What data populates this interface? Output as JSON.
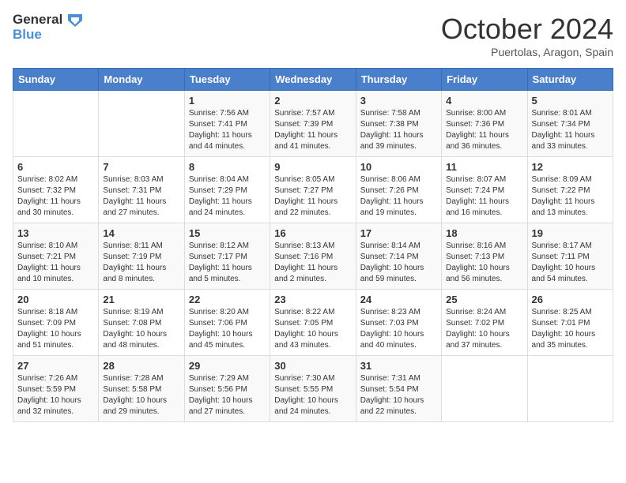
{
  "logo": {
    "line1": "General",
    "line2": "Blue"
  },
  "title": "October 2024",
  "subtitle": "Puertolas, Aragon, Spain",
  "days_header": [
    "Sunday",
    "Monday",
    "Tuesday",
    "Wednesday",
    "Thursday",
    "Friday",
    "Saturday"
  ],
  "weeks": [
    [
      {
        "num": "",
        "sunrise": "",
        "sunset": "",
        "daylight": ""
      },
      {
        "num": "",
        "sunrise": "",
        "sunset": "",
        "daylight": ""
      },
      {
        "num": "1",
        "sunrise": "Sunrise: 7:56 AM",
        "sunset": "Sunset: 7:41 PM",
        "daylight": "Daylight: 11 hours and 44 minutes."
      },
      {
        "num": "2",
        "sunrise": "Sunrise: 7:57 AM",
        "sunset": "Sunset: 7:39 PM",
        "daylight": "Daylight: 11 hours and 41 minutes."
      },
      {
        "num": "3",
        "sunrise": "Sunrise: 7:58 AM",
        "sunset": "Sunset: 7:38 PM",
        "daylight": "Daylight: 11 hours and 39 minutes."
      },
      {
        "num": "4",
        "sunrise": "Sunrise: 8:00 AM",
        "sunset": "Sunset: 7:36 PM",
        "daylight": "Daylight: 11 hours and 36 minutes."
      },
      {
        "num": "5",
        "sunrise": "Sunrise: 8:01 AM",
        "sunset": "Sunset: 7:34 PM",
        "daylight": "Daylight: 11 hours and 33 minutes."
      }
    ],
    [
      {
        "num": "6",
        "sunrise": "Sunrise: 8:02 AM",
        "sunset": "Sunset: 7:32 PM",
        "daylight": "Daylight: 11 hours and 30 minutes."
      },
      {
        "num": "7",
        "sunrise": "Sunrise: 8:03 AM",
        "sunset": "Sunset: 7:31 PM",
        "daylight": "Daylight: 11 hours and 27 minutes."
      },
      {
        "num": "8",
        "sunrise": "Sunrise: 8:04 AM",
        "sunset": "Sunset: 7:29 PM",
        "daylight": "Daylight: 11 hours and 24 minutes."
      },
      {
        "num": "9",
        "sunrise": "Sunrise: 8:05 AM",
        "sunset": "Sunset: 7:27 PM",
        "daylight": "Daylight: 11 hours and 22 minutes."
      },
      {
        "num": "10",
        "sunrise": "Sunrise: 8:06 AM",
        "sunset": "Sunset: 7:26 PM",
        "daylight": "Daylight: 11 hours and 19 minutes."
      },
      {
        "num": "11",
        "sunrise": "Sunrise: 8:07 AM",
        "sunset": "Sunset: 7:24 PM",
        "daylight": "Daylight: 11 hours and 16 minutes."
      },
      {
        "num": "12",
        "sunrise": "Sunrise: 8:09 AM",
        "sunset": "Sunset: 7:22 PM",
        "daylight": "Daylight: 11 hours and 13 minutes."
      }
    ],
    [
      {
        "num": "13",
        "sunrise": "Sunrise: 8:10 AM",
        "sunset": "Sunset: 7:21 PM",
        "daylight": "Daylight: 11 hours and 10 minutes."
      },
      {
        "num": "14",
        "sunrise": "Sunrise: 8:11 AM",
        "sunset": "Sunset: 7:19 PM",
        "daylight": "Daylight: 11 hours and 8 minutes."
      },
      {
        "num": "15",
        "sunrise": "Sunrise: 8:12 AM",
        "sunset": "Sunset: 7:17 PM",
        "daylight": "Daylight: 11 hours and 5 minutes."
      },
      {
        "num": "16",
        "sunrise": "Sunrise: 8:13 AM",
        "sunset": "Sunset: 7:16 PM",
        "daylight": "Daylight: 11 hours and 2 minutes."
      },
      {
        "num": "17",
        "sunrise": "Sunrise: 8:14 AM",
        "sunset": "Sunset: 7:14 PM",
        "daylight": "Daylight: 10 hours and 59 minutes."
      },
      {
        "num": "18",
        "sunrise": "Sunrise: 8:16 AM",
        "sunset": "Sunset: 7:13 PM",
        "daylight": "Daylight: 10 hours and 56 minutes."
      },
      {
        "num": "19",
        "sunrise": "Sunrise: 8:17 AM",
        "sunset": "Sunset: 7:11 PM",
        "daylight": "Daylight: 10 hours and 54 minutes."
      }
    ],
    [
      {
        "num": "20",
        "sunrise": "Sunrise: 8:18 AM",
        "sunset": "Sunset: 7:09 PM",
        "daylight": "Daylight: 10 hours and 51 minutes."
      },
      {
        "num": "21",
        "sunrise": "Sunrise: 8:19 AM",
        "sunset": "Sunset: 7:08 PM",
        "daylight": "Daylight: 10 hours and 48 minutes."
      },
      {
        "num": "22",
        "sunrise": "Sunrise: 8:20 AM",
        "sunset": "Sunset: 7:06 PM",
        "daylight": "Daylight: 10 hours and 45 minutes."
      },
      {
        "num": "23",
        "sunrise": "Sunrise: 8:22 AM",
        "sunset": "Sunset: 7:05 PM",
        "daylight": "Daylight: 10 hours and 43 minutes."
      },
      {
        "num": "24",
        "sunrise": "Sunrise: 8:23 AM",
        "sunset": "Sunset: 7:03 PM",
        "daylight": "Daylight: 10 hours and 40 minutes."
      },
      {
        "num": "25",
        "sunrise": "Sunrise: 8:24 AM",
        "sunset": "Sunset: 7:02 PM",
        "daylight": "Daylight: 10 hours and 37 minutes."
      },
      {
        "num": "26",
        "sunrise": "Sunrise: 8:25 AM",
        "sunset": "Sunset: 7:01 PM",
        "daylight": "Daylight: 10 hours and 35 minutes."
      }
    ],
    [
      {
        "num": "27",
        "sunrise": "Sunrise: 7:26 AM",
        "sunset": "Sunset: 5:59 PM",
        "daylight": "Daylight: 10 hours and 32 minutes."
      },
      {
        "num": "28",
        "sunrise": "Sunrise: 7:28 AM",
        "sunset": "Sunset: 5:58 PM",
        "daylight": "Daylight: 10 hours and 29 minutes."
      },
      {
        "num": "29",
        "sunrise": "Sunrise: 7:29 AM",
        "sunset": "Sunset: 5:56 PM",
        "daylight": "Daylight: 10 hours and 27 minutes."
      },
      {
        "num": "30",
        "sunrise": "Sunrise: 7:30 AM",
        "sunset": "Sunset: 5:55 PM",
        "daylight": "Daylight: 10 hours and 24 minutes."
      },
      {
        "num": "31",
        "sunrise": "Sunrise: 7:31 AM",
        "sunset": "Sunset: 5:54 PM",
        "daylight": "Daylight: 10 hours and 22 minutes."
      },
      {
        "num": "",
        "sunrise": "",
        "sunset": "",
        "daylight": ""
      },
      {
        "num": "",
        "sunrise": "",
        "sunset": "",
        "daylight": ""
      }
    ]
  ]
}
